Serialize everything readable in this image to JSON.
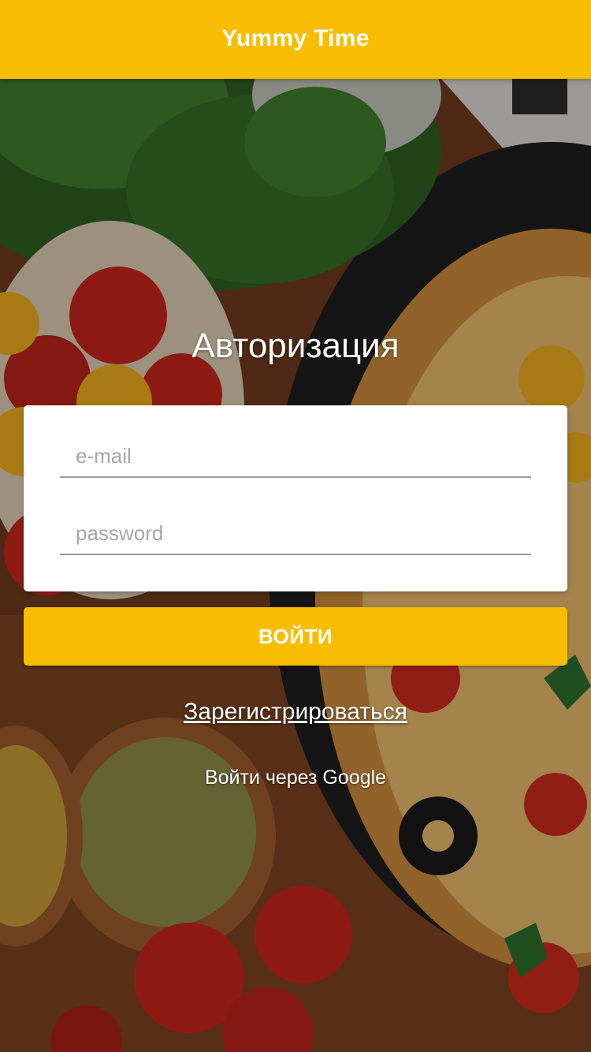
{
  "header": {
    "title": "Yummy Time"
  },
  "auth": {
    "title": "Авторизация",
    "email_placeholder": "e-mail",
    "password_placeholder": "password",
    "login_label": "ВОЙТИ",
    "register_label": "Зарегистрироваться",
    "google_label": "Войти через Google"
  },
  "colors": {
    "accent": "#f8bd00",
    "card": "#ffffff",
    "text_on_accent": "#ffffff",
    "placeholder": "#a6a6a6",
    "underline": "#9b9b9b"
  }
}
